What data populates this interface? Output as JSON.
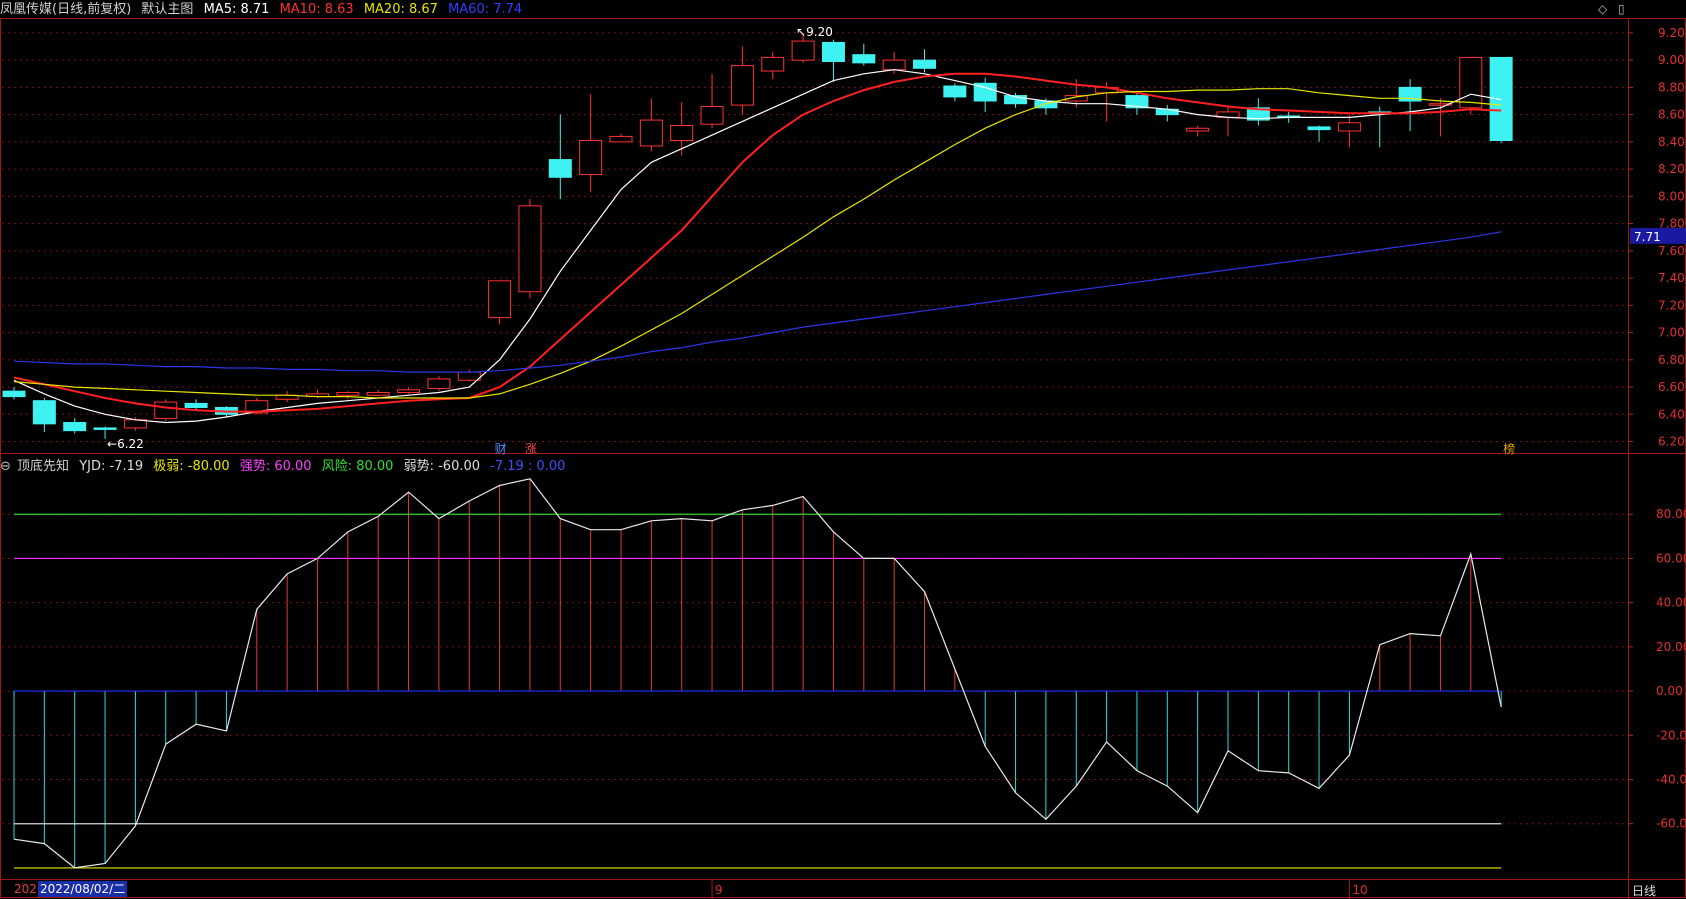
{
  "header": {
    "stock": "凤凰传媒(日线,前复权)",
    "template": "默认主图",
    "ma": [
      {
        "label": "MA5: 8.71",
        "color": "#ffffff"
      },
      {
        "label": "MA10: 8.63",
        "color": "#ff3030"
      },
      {
        "label": "MA20: 8.67",
        "color": "#e6e600"
      },
      {
        "label": "MA60: 7.74",
        "color": "#3040ff"
      }
    ],
    "corner_icons": [
      "diamond-icon",
      "window-icon"
    ]
  },
  "indicator_header": {
    "name": "顶底先知",
    "items": [
      {
        "label": "YJD: -7.19",
        "color": "#dddddd"
      },
      {
        "label": "极弱: -80.00",
        "color": "#e6e600"
      },
      {
        "label": "强势: 60.00",
        "color": "#ff40ff"
      },
      {
        "label": "风险: 80.00",
        "color": "#30e030"
      },
      {
        "label": "弱势: -60.00",
        "color": "#dddddd"
      },
      {
        "label": "-7.19 : 0.00",
        "color": "#4050ff"
      }
    ]
  },
  "footer": {
    "date_prefix": "202",
    "date": "2022/08/02/二",
    "right_label": "日线",
    "month_marks": [
      "9",
      "10"
    ]
  },
  "chart_data": [
    {
      "type": "candlestick",
      "title": "凤凰传媒(日线,前复权)",
      "ylim": [
        6.16,
        9.28
      ],
      "yticks": [
        6.2,
        6.4,
        6.6,
        6.8,
        7.0,
        7.2,
        7.4,
        7.6,
        7.8,
        8.0,
        8.2,
        8.4,
        8.6,
        8.8,
        9.0,
        9.2
      ],
      "price_tag": "7.71",
      "annotations": {
        "high": "9.20",
        "low": "6.22",
        "events": [
          "财",
          "涨",
          "榜"
        ]
      },
      "candles": [
        {
          "o": 6.57,
          "c": 6.53,
          "h": 6.6,
          "l": 6.51
        },
        {
          "o": 6.5,
          "c": 6.33,
          "h": 6.52,
          "l": 6.27
        },
        {
          "o": 6.34,
          "c": 6.28,
          "h": 6.37,
          "l": 6.26
        },
        {
          "o": 6.3,
          "c": 6.29,
          "h": 6.31,
          "l": 6.22
        },
        {
          "o": 6.3,
          "c": 6.36,
          "h": 6.38,
          "l": 6.28
        },
        {
          "o": 6.37,
          "c": 6.49,
          "h": 6.51,
          "l": 6.35
        },
        {
          "o": 6.48,
          "c": 6.45,
          "h": 6.51,
          "l": 6.43
        },
        {
          "o": 6.45,
          "c": 6.4,
          "h": 6.46,
          "l": 6.38
        },
        {
          "o": 6.41,
          "c": 6.5,
          "h": 6.52,
          "l": 6.4
        },
        {
          "o": 6.51,
          "c": 6.54,
          "h": 6.57,
          "l": 6.49
        },
        {
          "o": 6.53,
          "c": 6.55,
          "h": 6.58,
          "l": 6.52
        },
        {
          "o": 6.54,
          "c": 6.56,
          "h": 6.57,
          "l": 6.51
        },
        {
          "o": 6.54,
          "c": 6.56,
          "h": 6.58,
          "l": 6.53
        },
        {
          "o": 6.56,
          "c": 6.58,
          "h": 6.6,
          "l": 6.55
        },
        {
          "o": 6.59,
          "c": 6.66,
          "h": 6.68,
          "l": 6.57
        },
        {
          "o": 6.65,
          "c": 6.71,
          "h": 6.73,
          "l": 6.64
        },
        {
          "o": 7.11,
          "c": 7.38,
          "h": 7.38,
          "l": 7.06
        },
        {
          "o": 7.3,
          "c": 7.93,
          "h": 7.98,
          "l": 7.25
        },
        {
          "o": 8.27,
          "c": 8.14,
          "h": 8.6,
          "l": 7.98
        },
        {
          "o": 8.16,
          "c": 8.41,
          "h": 8.75,
          "l": 8.03
        },
        {
          "o": 8.4,
          "c": 8.44,
          "h": 8.46,
          "l": 8.4
        },
        {
          "o": 8.37,
          "c": 8.56,
          "h": 8.72,
          "l": 8.33
        },
        {
          "o": 8.41,
          "c": 8.52,
          "h": 8.69,
          "l": 8.3
        },
        {
          "o": 8.53,
          "c": 8.66,
          "h": 8.9,
          "l": 8.5
        },
        {
          "o": 8.67,
          "c": 8.96,
          "h": 9.1,
          "l": 8.6
        },
        {
          "o": 8.92,
          "c": 9.02,
          "h": 9.06,
          "l": 8.86
        },
        {
          "o": 9.0,
          "c": 9.14,
          "h": 9.2,
          "l": 8.98
        },
        {
          "o": 9.13,
          "c": 8.99,
          "h": 9.15,
          "l": 8.84
        },
        {
          "o": 9.04,
          "c": 8.98,
          "h": 9.12,
          "l": 8.96
        },
        {
          "o": 8.93,
          "c": 9.0,
          "h": 9.06,
          "l": 8.9
        },
        {
          "o": 9.0,
          "c": 8.94,
          "h": 9.08,
          "l": 8.91
        },
        {
          "o": 8.81,
          "c": 8.73,
          "h": 8.83,
          "l": 8.7
        },
        {
          "o": 8.83,
          "c": 8.7,
          "h": 8.87,
          "l": 8.62
        },
        {
          "o": 8.74,
          "c": 8.68,
          "h": 8.76,
          "l": 8.65
        },
        {
          "o": 8.7,
          "c": 8.65,
          "h": 8.72,
          "l": 8.6
        },
        {
          "o": 8.7,
          "c": 8.74,
          "h": 8.86,
          "l": 8.65
        },
        {
          "o": 8.76,
          "c": 8.8,
          "h": 8.84,
          "l": 8.55
        },
        {
          "o": 8.74,
          "c": 8.65,
          "h": 8.77,
          "l": 8.6
        },
        {
          "o": 8.64,
          "c": 8.6,
          "h": 8.67,
          "l": 8.55
        },
        {
          "o": 8.48,
          "c": 8.5,
          "h": 8.52,
          "l": 8.44
        },
        {
          "o": 8.58,
          "c": 8.62,
          "h": 8.66,
          "l": 8.44
        },
        {
          "o": 8.65,
          "c": 8.56,
          "h": 8.72,
          "l": 8.52
        },
        {
          "o": 8.59,
          "c": 8.58,
          "h": 8.62,
          "l": 8.54
        },
        {
          "o": 8.51,
          "c": 8.49,
          "h": 8.52,
          "l": 8.4
        },
        {
          "o": 8.48,
          "c": 8.54,
          "h": 8.6,
          "l": 8.36
        },
        {
          "o": 8.62,
          "c": 8.61,
          "h": 8.66,
          "l": 8.36
        },
        {
          "o": 8.8,
          "c": 8.7,
          "h": 8.86,
          "l": 8.48
        },
        {
          "o": 8.67,
          "c": 8.68,
          "h": 8.72,
          "l": 8.44
        },
        {
          "o": 8.65,
          "c": 9.02,
          "h": 9.02,
          "l": 8.6
        },
        {
          "o": 9.02,
          "c": 8.41,
          "h": 9.02,
          "l": 8.39
        }
      ],
      "series": [
        {
          "name": "MA5",
          "color": "#ffffff",
          "values": [
            6.65,
            6.55,
            6.46,
            6.4,
            6.36,
            6.34,
            6.35,
            6.38,
            6.42,
            6.45,
            6.48,
            6.5,
            6.52,
            6.54,
            6.56,
            6.6,
            6.8,
            7.1,
            7.45,
            7.75,
            8.05,
            8.25,
            8.35,
            8.45,
            8.55,
            8.65,
            8.75,
            8.85,
            8.9,
            8.93,
            8.9,
            8.85,
            8.8,
            8.73,
            8.7,
            8.68,
            8.68,
            8.66,
            8.64,
            8.6,
            8.58,
            8.57,
            8.58,
            8.58,
            8.58,
            8.6,
            8.62,
            8.65,
            8.75,
            8.71
          ]
        },
        {
          "name": "MA10",
          "color": "#ff2020",
          "values": [
            6.67,
            6.62,
            6.57,
            6.52,
            6.48,
            6.45,
            6.43,
            6.42,
            6.42,
            6.43,
            6.44,
            6.46,
            6.48,
            6.5,
            6.51,
            6.52,
            6.6,
            6.75,
            6.95,
            7.15,
            7.35,
            7.55,
            7.75,
            8.0,
            8.25,
            8.45,
            8.6,
            8.7,
            8.78,
            8.84,
            8.88,
            8.9,
            8.9,
            8.88,
            8.85,
            8.82,
            8.8,
            8.76,
            8.72,
            8.69,
            8.66,
            8.64,
            8.63,
            8.62,
            8.61,
            8.61,
            8.61,
            8.62,
            8.64,
            8.63
          ]
        },
        {
          "name": "MA20",
          "color": "#e6e600",
          "values": [
            6.64,
            6.62,
            6.6,
            6.59,
            6.58,
            6.57,
            6.56,
            6.55,
            6.54,
            6.54,
            6.53,
            6.53,
            6.52,
            6.52,
            6.52,
            6.52,
            6.55,
            6.62,
            6.7,
            6.79,
            6.9,
            7.02,
            7.14,
            7.28,
            7.42,
            7.56,
            7.7,
            7.85,
            7.98,
            8.12,
            8.25,
            8.38,
            8.5,
            8.6,
            8.68,
            8.73,
            8.76,
            8.77,
            8.77,
            8.78,
            8.78,
            8.79,
            8.79,
            8.76,
            8.74,
            8.72,
            8.72,
            8.7,
            8.69,
            8.67
          ]
        },
        {
          "name": "MA60",
          "color": "#2a36e6",
          "values": [
            6.79,
            6.78,
            6.77,
            6.77,
            6.76,
            6.75,
            6.75,
            6.74,
            6.74,
            6.73,
            6.73,
            6.72,
            6.72,
            6.71,
            6.71,
            6.71,
            6.72,
            6.74,
            6.76,
            6.79,
            6.82,
            6.86,
            6.89,
            6.93,
            6.96,
            7.0,
            7.04,
            7.07,
            7.1,
            7.13,
            7.16,
            7.19,
            7.22,
            7.25,
            7.28,
            7.31,
            7.34,
            7.37,
            7.4,
            7.43,
            7.46,
            7.49,
            7.52,
            7.55,
            7.58,
            7.61,
            7.64,
            7.67,
            7.7,
            7.74
          ]
        }
      ]
    },
    {
      "type": "line",
      "title": "顶底先知",
      "ylim": [
        -85,
        100
      ],
      "yticks": [
        80,
        60,
        40,
        20,
        0,
        -20,
        -40,
        -60
      ],
      "levels": [
        {
          "name": "风险",
          "value": 80,
          "color": "#30d030"
        },
        {
          "name": "强势",
          "value": 60,
          "color": "#ff30ff"
        },
        {
          "name": "零轴",
          "value": 0,
          "color": "#2030ff"
        },
        {
          "name": "弱势",
          "value": -60,
          "color": "#d8d8d8"
        },
        {
          "name": "极弱",
          "value": -80,
          "color": "#e6e600"
        }
      ],
      "series": [
        {
          "name": "YJD",
          "color": "#e8e8e8",
          "values": [
            -67,
            -69,
            -80,
            -78,
            -61,
            -24,
            -15,
            -18,
            37,
            53,
            60,
            72,
            79,
            90,
            78,
            86,
            93,
            96,
            78,
            73,
            73,
            77,
            78,
            77,
            82,
            84,
            88,
            72,
            60,
            60,
            45,
            10,
            -25,
            -46,
            -58,
            -43,
            -23,
            -36,
            -43,
            -55,
            -27,
            -36,
            -37,
            -44,
            -29,
            21,
            26,
            25,
            62,
            -7.19
          ]
        }
      ]
    }
  ]
}
